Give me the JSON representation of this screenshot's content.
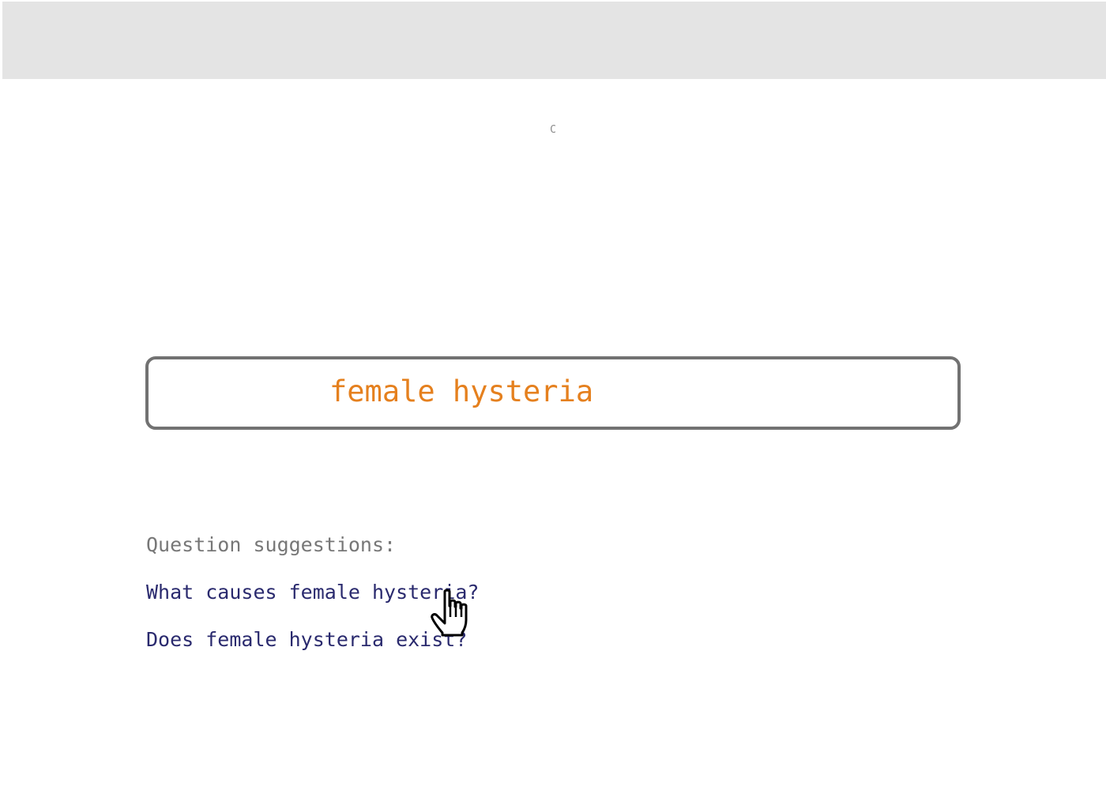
{
  "header": {
    "mark": "C"
  },
  "search": {
    "query": "female hysteria"
  },
  "suggestions": {
    "heading": "Question suggestions:",
    "items": [
      "What causes female hysteria?",
      "Does female hysteria exist?"
    ]
  },
  "colors": {
    "query_text": "#e5801e",
    "suggestion_link": "#2a2a6e",
    "heading_text": "#777777",
    "top_bar": "#e4e4e4",
    "search_border": "#727272"
  },
  "icons": {
    "pointer": "hand-pointer-cursor-icon"
  }
}
